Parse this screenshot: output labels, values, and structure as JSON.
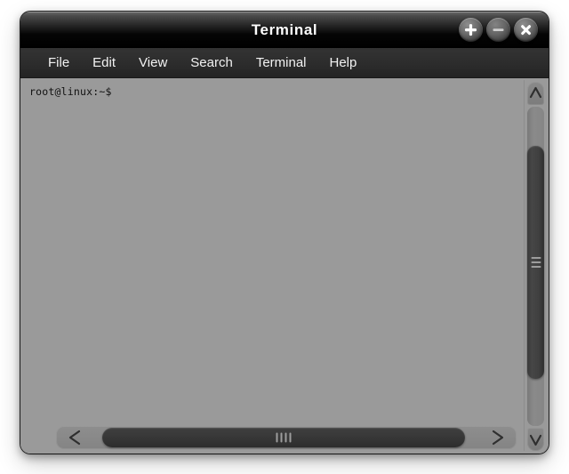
{
  "window": {
    "title": "Terminal",
    "controls": [
      {
        "name": "maximize-button",
        "glyph": "plus"
      },
      {
        "name": "minimize-button",
        "glyph": "minus"
      },
      {
        "name": "close-button",
        "glyph": "cross"
      }
    ]
  },
  "menubar": {
    "items": [
      {
        "label": "File"
      },
      {
        "label": "Edit"
      },
      {
        "label": "View"
      },
      {
        "label": "Search"
      },
      {
        "label": "Terminal"
      },
      {
        "label": "Help"
      }
    ]
  },
  "terminal": {
    "prompt": "root@linux:~$",
    "lines": [
      "root@linux:~$"
    ],
    "background_color": "#9a9a9a",
    "text_color": "#111111"
  },
  "scrollbars": {
    "vertical": {
      "up_arrow": "scroll-up-arrow",
      "down_arrow": "scroll-down-arrow",
      "grip_marks": 3
    },
    "horizontal": {
      "left_arrow": "<",
      "right_arrow": ">",
      "grip_marks": 4
    }
  },
  "colors": {
    "titlebar_top": "#6b6b6b",
    "titlebar_bottom": "#000000",
    "menubar": "#2c2c2c",
    "terminal_bg": "#9a9a9a",
    "scrollbar_thumb": "#3a3a3a"
  }
}
